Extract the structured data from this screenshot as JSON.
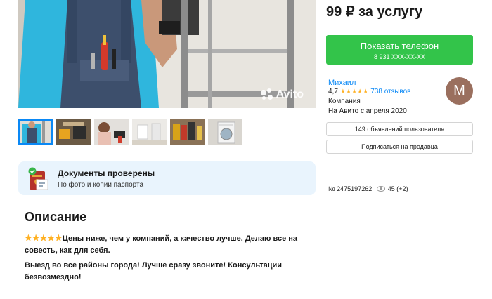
{
  "gallery": {
    "watermark": "Avito",
    "thumbnails": [
      "worker",
      "tools",
      "drill",
      "bathroom",
      "workshop",
      "washer"
    ]
  },
  "docs": {
    "title": "Документы проверены",
    "subtitle": "По фото и копии паспорта"
  },
  "description": {
    "heading": "Описание",
    "stars": "★★★★★",
    "paragraph1": "Цены ниже, чем у компаний, а качество лучше. Делаю все на совесть, как для себя.",
    "paragraph2": "Выезд во все районы города! Лучше сразу звоните! Консультации безвозмездно!"
  },
  "listing": {
    "price": "99 ₽ за услугу",
    "phone_button": "Показать телефон",
    "phone_masked": "8 931 XXX-XX-XX"
  },
  "seller": {
    "name": "Михаил",
    "rating": "4,7",
    "rating_value": 4.7,
    "stars": "★★★★★",
    "reviews": "738 отзывов",
    "type": "Компания",
    "since": "На Авито с апреля 2020",
    "avatar_letter": "М",
    "avatar_color": "#9a6f5e"
  },
  "actions": {
    "ads_button": "149 объявлений пользователя",
    "subscribe_button": "Подписаться на продавца"
  },
  "meta": {
    "ad_number": "№ 2475197262,",
    "views": "45 (+2)"
  },
  "colors": {
    "accent_green": "#33c44a",
    "link_blue": "#0a88f5",
    "star_orange": "#ffb021",
    "verified_bg": "#e9f4fd"
  }
}
